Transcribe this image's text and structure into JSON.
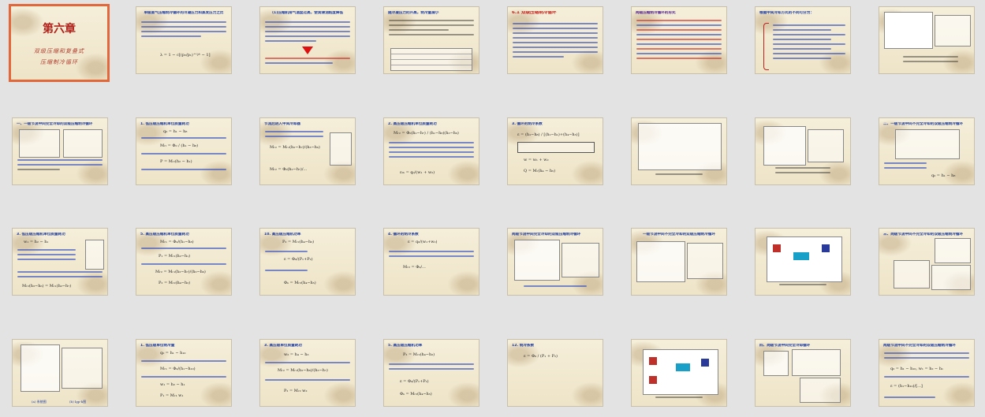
{
  "slides": [
    {
      "title": "第六章",
      "subtitle_1": "双级压缩和复叠式",
      "subtitle_2": "压缩制冷循环",
      "selected": true
    },
    {
      "title": "单级蒸气压缩制冷循环的冷凝压力和蒸发压力之比"
    },
    {
      "title": "(1)压缩机排气温度过高，使润滑油粘度降低"
    },
    {
      "title": "随冷凝压力的升高，制冷量减小"
    },
    {
      "title": "6.1 双级压缩制冷循环"
    },
    {
      "title": "两级压缩制冷循环的形式"
    },
    {
      "title": "根据中间冷却方式的不同可分为："
    },
    {
      "title": ""
    },
    {
      "title": "一、一级节流中间完全冷却的双级压缩制冷循环"
    },
    {
      "title": "1. 低压级压缩机单位质量耗功"
    },
    {
      "title": "节流后进入中间冷却器"
    },
    {
      "title": "2. 高压级压缩机单位质量耗功"
    },
    {
      "title": "3. 循环的制冷系数"
    },
    {
      "title": ""
    },
    {
      "title": ""
    },
    {
      "title": "二、一级节流中间不完全冷却的双级压缩制冷循环"
    },
    {
      "title": "3. 低压级压缩机单位质量耗功"
    },
    {
      "title": "5. 高压级压缩机单位质量耗功"
    },
    {
      "title": "10. 高压级压缩机功率"
    },
    {
      "title": "4. 循环的制冷系数"
    },
    {
      "title": "两级节流中间完全冷却的双级压缩制冷循环"
    },
    {
      "title": "一级节流中间不完全冷却的双级压缩制冷循环"
    },
    {
      "title": ""
    },
    {
      "title": "三、两级节流中间不完全冷却的双级压缩制冷循环"
    },
    {
      "title": ""
    },
    {
      "title": "1. 低压级单位制冷量"
    },
    {
      "title": "3. 高压级单位质量耗功"
    },
    {
      "title": "5. 高压级压缩机功率"
    },
    {
      "title": "12. 制冷系数"
    },
    {
      "title": ""
    },
    {
      "title": "四、两级节流中间完全冷却循环"
    },
    {
      "title": "两级节流中间不完全冷却的双级压缩制冷循环"
    }
  ],
  "slide1_labels": {
    "caption_1": "(a) 系统图",
    "caption_2": "(b) lgp-h图"
  }
}
